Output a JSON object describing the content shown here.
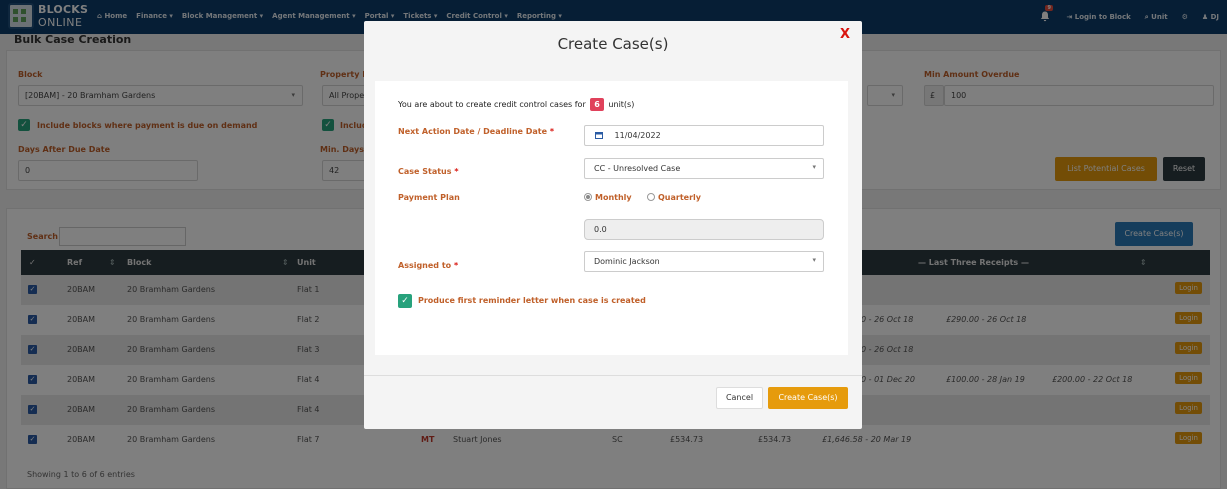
{
  "nav": {
    "logo_line1": "BLOCKS",
    "logo_line2": "ONLINE",
    "items": [
      "⌂ Home",
      "Finance ▾",
      "Block Management ▾",
      "Agent Management ▾",
      "Portal ▾",
      "Tickets ▾",
      "Credit Control ▾",
      "Reporting ▾"
    ],
    "bell_badge": "9",
    "login_to_block": "⇥ Login to Block",
    "unit_search": "⌕ Unit",
    "settings_icon": "⚙",
    "user": "♟ DJ"
  },
  "page": {
    "title": "Bulk Case Creation"
  },
  "filters": {
    "block_label": "Block",
    "block_value": "[20BAM] - 20 Bramham Gardens",
    "property_label": "Property M",
    "property_value": "All Prope",
    "min_amount_label": "Min Amount Overdue",
    "currency": "£",
    "min_amount_value": "100",
    "include_demand_label": "Include blocks where payment is due on demand",
    "include_second_label": "Includ",
    "days_after_label": "Days After Due Date",
    "days_after_value": "0",
    "min_days_label": "Min. Days",
    "min_days_value": "42",
    "list_btn": "List Potential Cases",
    "reset_btn": "Reset"
  },
  "table": {
    "search_label": "Search",
    "create_btn": "Create Case(s)",
    "headers": {
      "ref": "Ref",
      "block": "Block",
      "unit": "Unit",
      "receipts": "— Last Three Receipts —"
    },
    "rows": [
      {
        "ref": "20BAM",
        "block": "20 Bramham Gardens",
        "unit": "Flat 1",
        "code": "",
        "tenant": "",
        "type": "",
        "amt1": "",
        "amt2": "",
        "r1": "",
        "r2": "",
        "r3": "",
        "login": "Login"
      },
      {
        "ref": "20BAM",
        "block": "20 Bramham Gardens",
        "unit": "Flat 2",
        "code": "",
        "tenant": "",
        "type": "",
        "amt1": "",
        "amt2": "",
        "r1": "0 - 26 Oct 18",
        "r2": "£290.00 - 26 Oct 18",
        "r3": "",
        "login": "Login"
      },
      {
        "ref": "20BAM",
        "block": "20 Bramham Gardens",
        "unit": "Flat 3",
        "code": "",
        "tenant": "",
        "type": "",
        "amt1": "",
        "amt2": "",
        "r1": "0 - 26 Oct 18",
        "r2": "",
        "r3": "",
        "login": "Login"
      },
      {
        "ref": "20BAM",
        "block": "20 Bramham Gardens",
        "unit": "Flat 4",
        "code": "",
        "tenant": "",
        "type": "",
        "amt1": "",
        "amt2": "",
        "r1": "0 - 01 Dec 20",
        "r2": "£100.00 - 28 Jan 19",
        "r3": "£200.00 - 22 Oct 18",
        "login": "Login"
      },
      {
        "ref": "20BAM",
        "block": "20 Bramham Gardens",
        "unit": "Flat 4",
        "code": "",
        "tenant": "",
        "type": "",
        "amt1": "",
        "amt2": "",
        "r1": "",
        "r2": "",
        "r3": "",
        "login": "Login"
      },
      {
        "ref": "20BAM",
        "block": "20 Bramham Gardens",
        "unit": "Flat 7",
        "code": "MT",
        "tenant": "Stuart Jones",
        "type": "SC",
        "amt1": "£534.73",
        "amt2": "£534.73",
        "r1": "£1,646.58 - 20 Mar 19",
        "r2": "",
        "r3": "",
        "login": "Login"
      }
    ],
    "showing": "Showing 1 to 6 of 6 entries"
  },
  "modal": {
    "title": "Create Case(s)",
    "close": "X",
    "intro_before": "You are about to create credit control cases for",
    "unit_count": "6",
    "intro_after": "unit(s)",
    "next_action_label": "Next Action Date / Deadline Date",
    "required_mark": "*",
    "date_value": "11/04/2022",
    "case_status_label": "Case Status",
    "case_status_value": "CC - Unresolved Case",
    "payment_plan_label": "Payment Plan",
    "monthly": "Monthly",
    "quarterly": "Quarterly",
    "plan_amount": "0.0",
    "assigned_label": "Assigned to",
    "assigned_value": "Dominic Jackson",
    "reminder_label": "Produce first reminder letter when case is created",
    "cancel_btn": "Cancel",
    "create_btn": "Create Case(s)"
  }
}
